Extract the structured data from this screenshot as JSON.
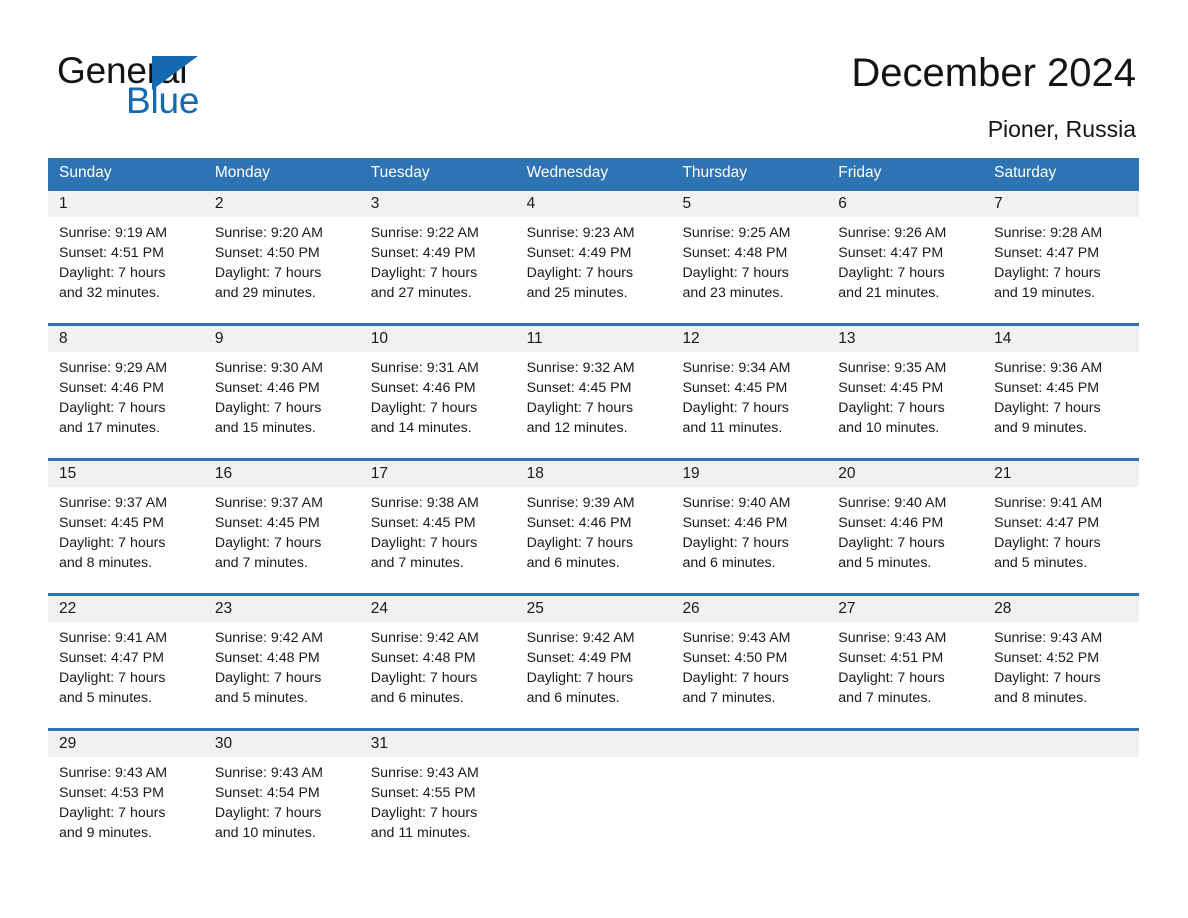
{
  "brand": {
    "name_part1": "General",
    "name_part2": "Blue",
    "triangle_icon": "triangle-logo-icon",
    "accent_color": "#1569b0"
  },
  "header": {
    "title": "December 2024",
    "location": "Pioner, Russia"
  },
  "theme": {
    "header_blue": "#2e73b4",
    "rule_blue": "#2e73b4",
    "daynum_band": "#f1f1f1",
    "text": "#1a1a1a"
  },
  "weekdays": [
    "Sunday",
    "Monday",
    "Tuesday",
    "Wednesday",
    "Thursday",
    "Friday",
    "Saturday"
  ],
  "weeks": [
    {
      "days": [
        {
          "day": "1",
          "sunrise": "Sunrise: 9:19 AM",
          "sunset": "Sunset: 4:51 PM",
          "daylight1": "Daylight: 7 hours",
          "daylight2": "and 32 minutes."
        },
        {
          "day": "2",
          "sunrise": "Sunrise: 9:20 AM",
          "sunset": "Sunset: 4:50 PM",
          "daylight1": "Daylight: 7 hours",
          "daylight2": "and 29 minutes."
        },
        {
          "day": "3",
          "sunrise": "Sunrise: 9:22 AM",
          "sunset": "Sunset: 4:49 PM",
          "daylight1": "Daylight: 7 hours",
          "daylight2": "and 27 minutes."
        },
        {
          "day": "4",
          "sunrise": "Sunrise: 9:23 AM",
          "sunset": "Sunset: 4:49 PM",
          "daylight1": "Daylight: 7 hours",
          "daylight2": "and 25 minutes."
        },
        {
          "day": "5",
          "sunrise": "Sunrise: 9:25 AM",
          "sunset": "Sunset: 4:48 PM",
          "daylight1": "Daylight: 7 hours",
          "daylight2": "and 23 minutes."
        },
        {
          "day": "6",
          "sunrise": "Sunrise: 9:26 AM",
          "sunset": "Sunset: 4:47 PM",
          "daylight1": "Daylight: 7 hours",
          "daylight2": "and 21 minutes."
        },
        {
          "day": "7",
          "sunrise": "Sunrise: 9:28 AM",
          "sunset": "Sunset: 4:47 PM",
          "daylight1": "Daylight: 7 hours",
          "daylight2": "and 19 minutes."
        }
      ]
    },
    {
      "days": [
        {
          "day": "8",
          "sunrise": "Sunrise: 9:29 AM",
          "sunset": "Sunset: 4:46 PM",
          "daylight1": "Daylight: 7 hours",
          "daylight2": "and 17 minutes."
        },
        {
          "day": "9",
          "sunrise": "Sunrise: 9:30 AM",
          "sunset": "Sunset: 4:46 PM",
          "daylight1": "Daylight: 7 hours",
          "daylight2": "and 15 minutes."
        },
        {
          "day": "10",
          "sunrise": "Sunrise: 9:31 AM",
          "sunset": "Sunset: 4:46 PM",
          "daylight1": "Daylight: 7 hours",
          "daylight2": "and 14 minutes."
        },
        {
          "day": "11",
          "sunrise": "Sunrise: 9:32 AM",
          "sunset": "Sunset: 4:45 PM",
          "daylight1": "Daylight: 7 hours",
          "daylight2": "and 12 minutes."
        },
        {
          "day": "12",
          "sunrise": "Sunrise: 9:34 AM",
          "sunset": "Sunset: 4:45 PM",
          "daylight1": "Daylight: 7 hours",
          "daylight2": "and 11 minutes."
        },
        {
          "day": "13",
          "sunrise": "Sunrise: 9:35 AM",
          "sunset": "Sunset: 4:45 PM",
          "daylight1": "Daylight: 7 hours",
          "daylight2": "and 10 minutes."
        },
        {
          "day": "14",
          "sunrise": "Sunrise: 9:36 AM",
          "sunset": "Sunset: 4:45 PM",
          "daylight1": "Daylight: 7 hours",
          "daylight2": "and 9 minutes."
        }
      ]
    },
    {
      "days": [
        {
          "day": "15",
          "sunrise": "Sunrise: 9:37 AM",
          "sunset": "Sunset: 4:45 PM",
          "daylight1": "Daylight: 7 hours",
          "daylight2": "and 8 minutes."
        },
        {
          "day": "16",
          "sunrise": "Sunrise: 9:37 AM",
          "sunset": "Sunset: 4:45 PM",
          "daylight1": "Daylight: 7 hours",
          "daylight2": "and 7 minutes."
        },
        {
          "day": "17",
          "sunrise": "Sunrise: 9:38 AM",
          "sunset": "Sunset: 4:45 PM",
          "daylight1": "Daylight: 7 hours",
          "daylight2": "and 7 minutes."
        },
        {
          "day": "18",
          "sunrise": "Sunrise: 9:39 AM",
          "sunset": "Sunset: 4:46 PM",
          "daylight1": "Daylight: 7 hours",
          "daylight2": "and 6 minutes."
        },
        {
          "day": "19",
          "sunrise": "Sunrise: 9:40 AM",
          "sunset": "Sunset: 4:46 PM",
          "daylight1": "Daylight: 7 hours",
          "daylight2": "and 6 minutes."
        },
        {
          "day": "20",
          "sunrise": "Sunrise: 9:40 AM",
          "sunset": "Sunset: 4:46 PM",
          "daylight1": "Daylight: 7 hours",
          "daylight2": "and 5 minutes."
        },
        {
          "day": "21",
          "sunrise": "Sunrise: 9:41 AM",
          "sunset": "Sunset: 4:47 PM",
          "daylight1": "Daylight: 7 hours",
          "daylight2": "and 5 minutes."
        }
      ]
    },
    {
      "days": [
        {
          "day": "22",
          "sunrise": "Sunrise: 9:41 AM",
          "sunset": "Sunset: 4:47 PM",
          "daylight1": "Daylight: 7 hours",
          "daylight2": "and 5 minutes."
        },
        {
          "day": "23",
          "sunrise": "Sunrise: 9:42 AM",
          "sunset": "Sunset: 4:48 PM",
          "daylight1": "Daylight: 7 hours",
          "daylight2": "and 5 minutes."
        },
        {
          "day": "24",
          "sunrise": "Sunrise: 9:42 AM",
          "sunset": "Sunset: 4:48 PM",
          "daylight1": "Daylight: 7 hours",
          "daylight2": "and 6 minutes."
        },
        {
          "day": "25",
          "sunrise": "Sunrise: 9:42 AM",
          "sunset": "Sunset: 4:49 PM",
          "daylight1": "Daylight: 7 hours",
          "daylight2": "and 6 minutes."
        },
        {
          "day": "26",
          "sunrise": "Sunrise: 9:43 AM",
          "sunset": "Sunset: 4:50 PM",
          "daylight1": "Daylight: 7 hours",
          "daylight2": "and 7 minutes."
        },
        {
          "day": "27",
          "sunrise": "Sunrise: 9:43 AM",
          "sunset": "Sunset: 4:51 PM",
          "daylight1": "Daylight: 7 hours",
          "daylight2": "and 7 minutes."
        },
        {
          "day": "28",
          "sunrise": "Sunrise: 9:43 AM",
          "sunset": "Sunset: 4:52 PM",
          "daylight1": "Daylight: 7 hours",
          "daylight2": "and 8 minutes."
        }
      ]
    },
    {
      "days": [
        {
          "day": "29",
          "sunrise": "Sunrise: 9:43 AM",
          "sunset": "Sunset: 4:53 PM",
          "daylight1": "Daylight: 7 hours",
          "daylight2": "and 9 minutes."
        },
        {
          "day": "30",
          "sunrise": "Sunrise: 9:43 AM",
          "sunset": "Sunset: 4:54 PM",
          "daylight1": "Daylight: 7 hours",
          "daylight2": "and 10 minutes."
        },
        {
          "day": "31",
          "sunrise": "Sunrise: 9:43 AM",
          "sunset": "Sunset: 4:55 PM",
          "daylight1": "Daylight: 7 hours",
          "daylight2": "and 11 minutes."
        },
        {
          "day": "",
          "sunrise": "",
          "sunset": "",
          "daylight1": "",
          "daylight2": "",
          "empty": true
        },
        {
          "day": "",
          "sunrise": "",
          "sunset": "",
          "daylight1": "",
          "daylight2": "",
          "empty": true
        },
        {
          "day": "",
          "sunrise": "",
          "sunset": "",
          "daylight1": "",
          "daylight2": "",
          "empty": true
        },
        {
          "day": "",
          "sunrise": "",
          "sunset": "",
          "daylight1": "",
          "daylight2": "",
          "empty": true
        }
      ]
    }
  ]
}
